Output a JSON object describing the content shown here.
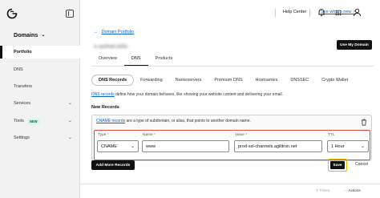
{
  "topbar": {
    "whats_new": "See what's new",
    "help_center": "Help Center"
  },
  "sidebar": {
    "section_title": "Domains",
    "items": [
      {
        "label": "Portfolio",
        "active": true
      },
      {
        "label": "DNS"
      },
      {
        "label": "Transfers"
      },
      {
        "label": "Services",
        "chevron": true
      },
      {
        "label": "Tools",
        "badge": "NEW",
        "chevron": true
      },
      {
        "label": "Settings",
        "chevron": true
      }
    ]
  },
  "page": {
    "back_link": "Domain Portfolio",
    "domain_name": "c-ashol.info",
    "use_domain_button": "Use My Domain",
    "tabs": [
      "Overview",
      "DNS",
      "Products"
    ],
    "active_tab": "DNS",
    "subtabs": [
      "DNS Records",
      "Forwarding",
      "Nameservers",
      "Premium DNS",
      "Hostnames",
      "DNSSEC",
      "Crypto Wallet"
    ],
    "active_subtab": "DNS Records",
    "description_link": "DNS records",
    "description_text": " define how your domain behaves, like showing your website content and delivering your email.",
    "new_records_heading": "New Records"
  },
  "record_card": {
    "info_link": "CNAME records",
    "info_text": " are a type of subdomain, or alias, that points to another domain name.",
    "fields": {
      "type_label": "Type",
      "type_value": "CNAME",
      "name_label": "Name",
      "name_value": "www",
      "value_label": "Value",
      "value_value": "prod-ssl-channels.agilitron.net",
      "ttl_label": "TTL",
      "ttl_value": "1 Hour"
    },
    "required_mark": "*"
  },
  "buttons": {
    "add_more": "Add More Records",
    "save": "Save",
    "cancel": "Cancel"
  },
  "footer": {
    "filters": "Filters",
    "actions": "Actions"
  },
  "colors": {
    "link": "#0a5fcb",
    "highlight_red": "#e64a3d",
    "highlight_yellow": "#f0b400",
    "primary_button": "#111111"
  }
}
